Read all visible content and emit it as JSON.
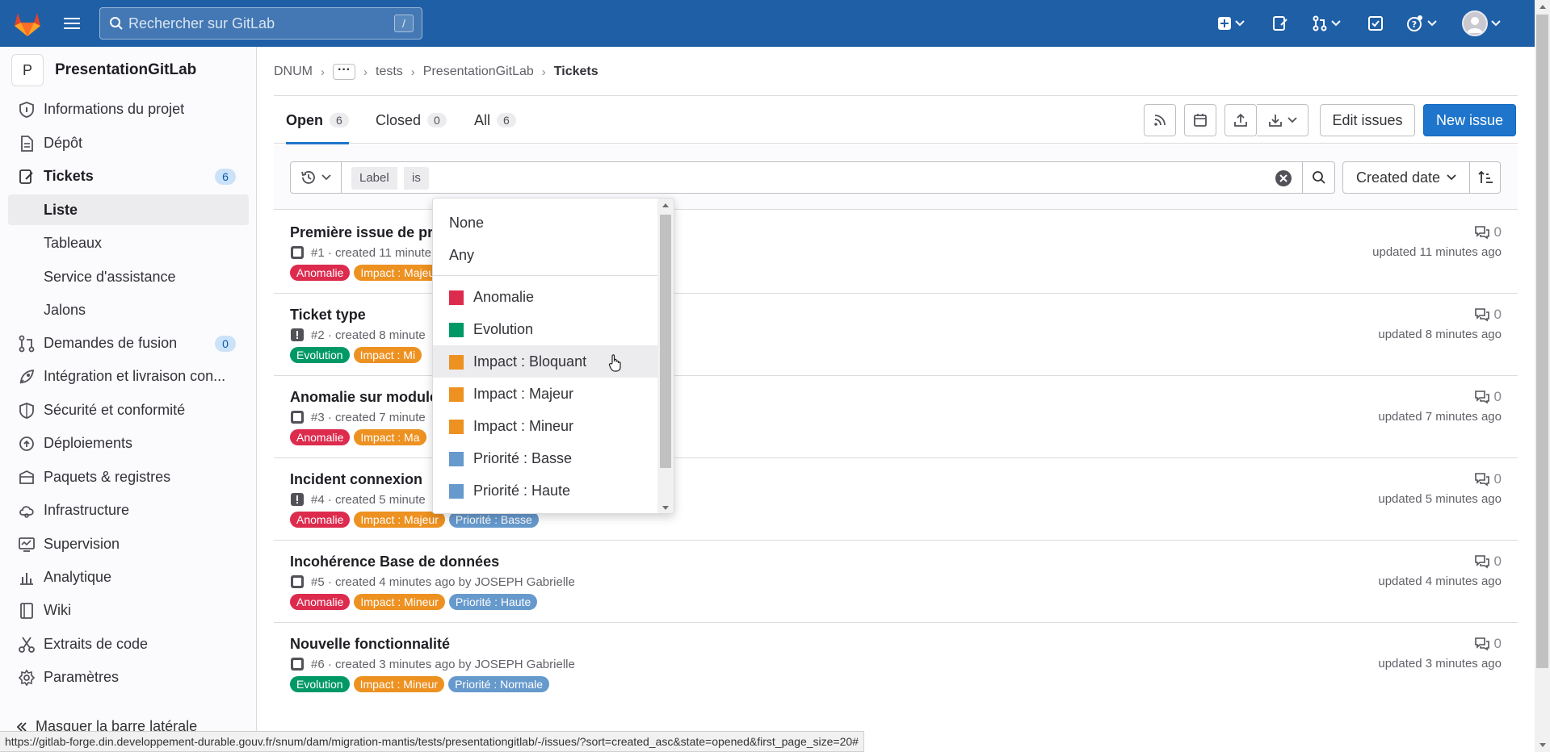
{
  "topbar": {
    "search_placeholder": "Rechercher sur GitLab",
    "search_shortcut": "/"
  },
  "sidebar": {
    "project_initial": "P",
    "project_name": "PresentationGitLab",
    "items": [
      {
        "label": "Informations du projet",
        "icon": "info-icon"
      },
      {
        "label": "Dépôt",
        "icon": "document-icon"
      },
      {
        "label": "Tickets",
        "icon": "issues-icon",
        "badge": "6"
      },
      {
        "label": "Liste"
      },
      {
        "label": "Tableaux"
      },
      {
        "label": "Service d'assistance"
      },
      {
        "label": "Jalons"
      },
      {
        "label": "Demandes de fusion",
        "icon": "merge-request-icon",
        "badge": "0"
      },
      {
        "label": "Intégration et livraison con...",
        "icon": "rocket-icon"
      },
      {
        "label": "Sécurité et conformité",
        "icon": "shield-icon"
      },
      {
        "label": "Déploiements",
        "icon": "deployments-icon"
      },
      {
        "label": "Paquets & registres",
        "icon": "package-icon"
      },
      {
        "label": "Infrastructure",
        "icon": "cloud-icon"
      },
      {
        "label": "Supervision",
        "icon": "monitor-icon"
      },
      {
        "label": "Analytique",
        "icon": "chart-icon"
      },
      {
        "label": "Wiki",
        "icon": "book-icon"
      },
      {
        "label": "Extraits de code",
        "icon": "snippet-icon"
      },
      {
        "label": "Paramètres",
        "icon": "settings-icon"
      }
    ],
    "collapse_label": "Masquer la barre latérale"
  },
  "breadcrumb": {
    "items": [
      "DNUM",
      "tests",
      "PresentationGitLab"
    ],
    "current": "Tickets"
  },
  "tabs": [
    {
      "label": "Open",
      "count": "6"
    },
    {
      "label": "Closed",
      "count": "0"
    },
    {
      "label": "All",
      "count": "6"
    }
  ],
  "toolbar": {
    "edit_label": "Edit issues",
    "new_label": "New issue"
  },
  "filter": {
    "token_key": "Label",
    "token_op": "is",
    "sort_label": "Created date"
  },
  "label_colors": {
    "Anomalie": "#dd2b4e",
    "Evolution": "#009966",
    "Impact": "#ed9121",
    "Priorite": "#6699cc"
  },
  "issues": [
    {
      "title": "Première issue de pre",
      "meta": "#1 · created 11 minute",
      "type": "issue",
      "labels": [
        {
          "text": "Anomalie",
          "color": "#dd2b4e"
        },
        {
          "text": "Impact : Majeur",
          "color": "#ed9121"
        }
      ],
      "comments": "0",
      "updated": "updated 11 minutes ago"
    },
    {
      "title": "Ticket type",
      "meta": "#2 · created 8 minute",
      "type": "incident",
      "labels": [
        {
          "text": "Evolution",
          "color": "#009966"
        },
        {
          "text": "Impact : Mi",
          "color": "#ed9121"
        }
      ],
      "comments": "0",
      "updated": "updated 8 minutes ago"
    },
    {
      "title": "Anomalie sur module",
      "meta": "#3 · created 7 minute",
      "type": "issue",
      "labels": [
        {
          "text": "Anomalie",
          "color": "#dd2b4e"
        },
        {
          "text": "Impact : Ma",
          "color": "#ed9121"
        }
      ],
      "comments": "0",
      "updated": "updated 7 minutes ago"
    },
    {
      "title": "Incident connexion",
      "meta": "#4 · created 5 minute",
      "type": "incident",
      "labels": [
        {
          "text": "Anomalie",
          "color": "#dd2b4e"
        },
        {
          "text": "Impact : Majeur",
          "color": "#ed9121"
        },
        {
          "text": "Priorité : Basse",
          "color": "#6699cc"
        }
      ],
      "comments": "0",
      "updated": "updated 5 minutes ago"
    },
    {
      "title": "Incohérence Base de données",
      "meta": "#5 · created 4 minutes ago by JOSEPH Gabrielle",
      "type": "issue",
      "labels": [
        {
          "text": "Anomalie",
          "color": "#dd2b4e"
        },
        {
          "text": "Impact : Mineur",
          "color": "#ed9121"
        },
        {
          "text": "Priorité : Haute",
          "color": "#6699cc"
        }
      ],
      "comments": "0",
      "updated": "updated 4 minutes ago"
    },
    {
      "title": "Nouvelle fonctionnalité",
      "meta": "#6 · created 3 minutes ago by JOSEPH Gabrielle",
      "type": "issue",
      "labels": [
        {
          "text": "Evolution",
          "color": "#009966"
        },
        {
          "text": "Impact : Mineur",
          "color": "#ed9121"
        },
        {
          "text": "Priorité : Normale",
          "color": "#6699cc"
        }
      ],
      "comments": "0",
      "updated": "updated 3 minutes ago"
    }
  ],
  "dropdown": {
    "special": [
      "None",
      "Any"
    ],
    "labels": [
      {
        "text": "Anomalie",
        "color": "#dd2b4e"
      },
      {
        "text": "Evolution",
        "color": "#009966"
      },
      {
        "text": "Impact : Bloquant",
        "color": "#ed9121"
      },
      {
        "text": "Impact : Majeur",
        "color": "#ed9121"
      },
      {
        "text": "Impact : Mineur",
        "color": "#ed9121"
      },
      {
        "text": "Priorité : Basse",
        "color": "#6699cc"
      },
      {
        "text": "Priorité : Haute",
        "color": "#6699cc"
      }
    ]
  },
  "statusbar": {
    "url": "https://gitlab-forge.din.developpement-durable.gouv.fr/snum/dam/migration-mantis/tests/presentationgitlab/-/issues/?sort=created_asc&state=opened&first_page_size=20#"
  }
}
